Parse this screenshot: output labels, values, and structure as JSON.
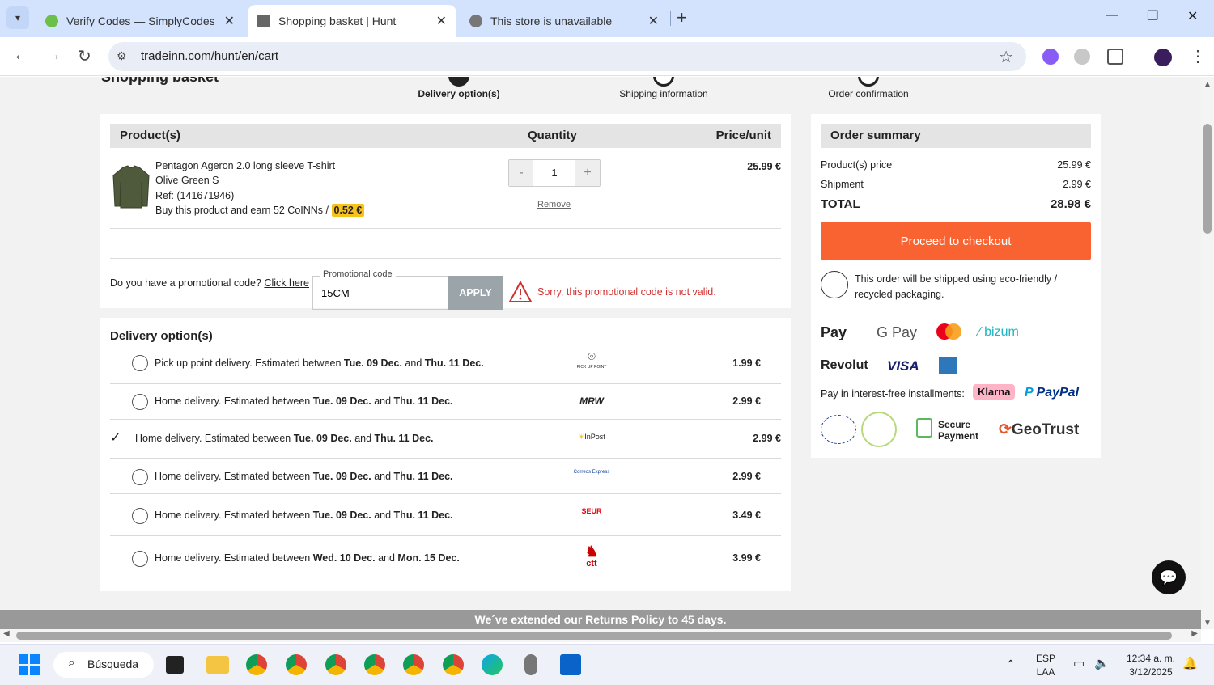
{
  "browser": {
    "tabs": [
      {
        "title": "Verify Codes — SimplyCodes",
        "active": false
      },
      {
        "title": "Shopping basket | Hunt",
        "active": true
      },
      {
        "title": "This store is unavailable",
        "active": false
      }
    ],
    "url": "tradeinn.com/hunt/en/cart"
  },
  "steps": {
    "title_peek": "Shopping basket",
    "items": [
      "Delivery option(s)",
      "Shipping information",
      "Order confirmation"
    ]
  },
  "cart": {
    "headers": {
      "product": "Product(s)",
      "quantity": "Quantity",
      "price": "Price/unit"
    },
    "item": {
      "name": "Pentagon Ageron 2.0 long sleeve T-shirt",
      "variant": "Olive Green S",
      "ref": "Ref: (141671946)",
      "coins_text": "Buy this product and earn 52 CoINNs /",
      "coins_value": "0.52 €",
      "quantity": "1",
      "remove": "Remove",
      "price": "25.99 €"
    }
  },
  "promo": {
    "question": "Do you have a promotional code?",
    "link": "Click here",
    "field_label": "Promotional code",
    "value": "15CM",
    "apply": "APPLY",
    "error": "Sorry, this promotional code is not valid."
  },
  "delivery": {
    "title": "Delivery option(s)",
    "options": [
      {
        "text": "Pick up point delivery. Estimated between ",
        "d1": "Tue. 09 Dec.",
        "mid": " and ",
        "d2": "Thu. 11 Dec.",
        "carrier": "PICK UP POINT",
        "price": "1.99 €",
        "selected": false
      },
      {
        "text": "Home delivery. Estimated between ",
        "d1": "Tue. 09 Dec.",
        "mid": " and ",
        "d2": "Thu. 11 Dec.",
        "carrier": "MRW",
        "price": "2.99 €",
        "selected": false
      },
      {
        "text": "Home delivery. Estimated between ",
        "d1": "Tue. 09 Dec.",
        "mid": " and ",
        "d2": "Thu. 11 Dec.",
        "carrier": "InPost",
        "price": "2.99 €",
        "selected": true
      },
      {
        "text": "Home delivery. Estimated between ",
        "d1": "Tue. 09 Dec.",
        "mid": " and ",
        "d2": "Thu. 11 Dec.",
        "carrier": "Correos Express",
        "price": "2.99 €",
        "selected": false
      },
      {
        "text": "Home delivery. Estimated between ",
        "d1": "Tue. 09 Dec.",
        "mid": " and ",
        "d2": "Thu. 11 Dec.",
        "carrier": "SEUR",
        "price": "3.49 €",
        "selected": false
      },
      {
        "text": "Home delivery. Estimated between ",
        "d1": "Wed. 10 Dec.",
        "mid": " and ",
        "d2": "Mon. 15 Dec.",
        "carrier": "ctt",
        "price": "3.99 €",
        "selected": false
      }
    ]
  },
  "summary": {
    "title": "Order summary",
    "products_label": "Product(s) price",
    "products_value": "25.99 €",
    "shipment_label": "Shipment",
    "shipment_value": "2.99 €",
    "total_label": "TOTAL",
    "total_value": "28.98 €",
    "checkout": "Proceed to checkout",
    "eco": "This order will be shipped using eco-friendly / recycled packaging.",
    "payments": [
      "Pay",
      "G Pay",
      "bizum",
      "Revolut",
      "VISA",
      "PayPal"
    ],
    "installments": "Pay in interest-free installments:",
    "klarna": "Klarna",
    "secure": "Secure Payment",
    "geotrust": "GeoTrust"
  },
  "banner": "We´ve extended our Returns Policy to 45 days.",
  "taskbar": {
    "search": "Búsqueda",
    "lang1": "ESP",
    "lang2": "LAA",
    "time": "12:34 a. m.",
    "date": "3/12/2025"
  },
  "colors": {
    "accent": "#f96332",
    "error": "#d32f2f",
    "coin": "#f7c21a"
  }
}
